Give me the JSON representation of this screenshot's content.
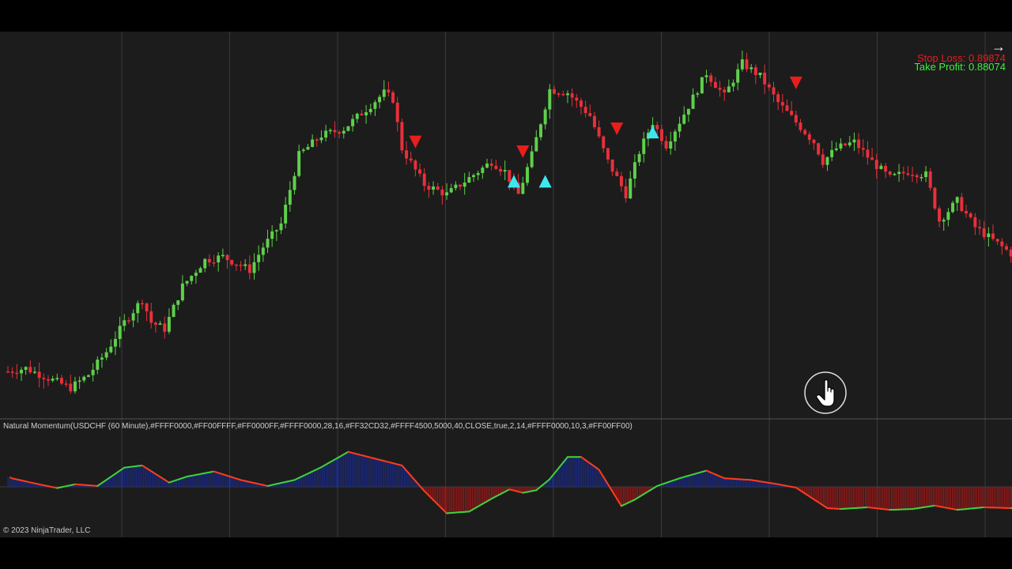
{
  "chart": {
    "stop_loss_label": "Stop Loss: 0.89874",
    "take_profit_label": "Take Profit: 0.88074",
    "indicator_label": "Natural Momentum(USDCHF (60 Minute),#FFFF0000,#FF00FFFF,#FF0000FF,#FFFF0000,28,16,#FF32CD32,#FFFF4500,5000,40,CLOSE,true,2,14,#FFFF0000,10,3,#FF00FF00)",
    "copyright": "© 2023 NinjaTrader, LLC"
  },
  "colors": {
    "background": "#1c1c1c",
    "grid": "#3a3a3a",
    "up_candle": "#5ed14a",
    "down_candle": "#e8303a",
    "buy_marker": "#3fe6ef",
    "sell_marker": "#e81e1e",
    "momentum_up": "#3fd13f",
    "momentum_down": "#ff3b1f",
    "histogram_positive": "#1a2a8a",
    "histogram_negative": "#a01818"
  },
  "chart_data": {
    "type": "candlestick",
    "symbol": "USDCHF",
    "timeframe": "60 Minute",
    "close_path": [
      [
        0,
        0.06
      ],
      [
        4,
        0.07
      ],
      [
        9,
        0.04
      ],
      [
        14,
        0.01
      ],
      [
        18,
        0.05
      ],
      [
        22,
        0.12
      ],
      [
        26,
        0.21
      ],
      [
        30,
        0.28
      ],
      [
        32,
        0.21
      ],
      [
        35,
        0.19
      ],
      [
        39,
        0.32
      ],
      [
        44,
        0.4
      ],
      [
        48,
        0.41
      ],
      [
        51,
        0.39
      ],
      [
        54,
        0.37
      ],
      [
        57,
        0.44
      ],
      [
        61,
        0.51
      ],
      [
        65,
        0.72
      ],
      [
        70,
        0.78
      ],
      [
        75,
        0.8
      ],
      [
        80,
        0.86
      ],
      [
        84,
        0.91
      ],
      [
        86,
        0.89
      ],
      [
        88,
        0.74
      ],
      [
        93,
        0.63
      ],
      [
        98,
        0.6
      ],
      [
        104,
        0.66
      ],
      [
        108,
        0.7
      ],
      [
        111,
        0.67
      ],
      [
        114,
        0.6
      ],
      [
        117,
        0.72
      ],
      [
        121,
        0.92
      ],
      [
        125,
        0.91
      ],
      [
        130,
        0.84
      ],
      [
        134,
        0.7
      ],
      [
        138,
        0.6
      ],
      [
        141,
        0.73
      ],
      [
        144,
        0.82
      ],
      [
        147,
        0.75
      ],
      [
        152,
        0.87
      ],
      [
        156,
        0.97
      ],
      [
        160,
        0.9
      ],
      [
        164,
        1.0
      ],
      [
        168,
        0.96
      ],
      [
        172,
        0.88
      ],
      [
        176,
        0.82
      ],
      [
        180,
        0.76
      ],
      [
        182,
        0.7
      ],
      [
        185,
        0.74
      ],
      [
        189,
        0.76
      ],
      [
        193,
        0.7
      ],
      [
        197,
        0.65
      ],
      [
        201,
        0.67
      ],
      [
        205,
        0.66
      ],
      [
        208,
        0.52
      ],
      [
        212,
        0.58
      ],
      [
        216,
        0.5
      ],
      [
        220,
        0.46
      ],
      [
        224,
        0.42
      ]
    ],
    "buy_signals": [
      [
        113,
        0.64
      ],
      [
        120,
        0.64
      ],
      [
        144,
        0.79
      ]
    ],
    "sell_signals": [
      [
        91,
        0.76
      ],
      [
        115,
        0.73
      ],
      [
        136,
        0.8
      ],
      [
        176,
        0.94
      ]
    ],
    "momentum": {
      "range": [
        -1,
        1
      ],
      "path": [
        [
          0,
          0.22
        ],
        [
          6,
          0.08
        ],
        [
          11,
          -0.03
        ],
        [
          15,
          0.06
        ],
        [
          20,
          0.02
        ],
        [
          26,
          0.45
        ],
        [
          30,
          0.5
        ],
        [
          36,
          0.1
        ],
        [
          40,
          0.24
        ],
        [
          46,
          0.36
        ],
        [
          52,
          0.16
        ],
        [
          58,
          0.02
        ],
        [
          64,
          0.16
        ],
        [
          70,
          0.46
        ],
        [
          76,
          0.82
        ],
        [
          82,
          0.66
        ],
        [
          88,
          0.5
        ],
        [
          93,
          -0.1
        ],
        [
          98,
          -0.62
        ],
        [
          103,
          -0.58
        ],
        [
          108,
          -0.28
        ],
        [
          112,
          -0.06
        ],
        [
          115,
          -0.14
        ],
        [
          118,
          -0.08
        ],
        [
          121,
          0.18
        ],
        [
          125,
          0.7
        ],
        [
          128,
          0.7
        ],
        [
          132,
          0.4
        ],
        [
          137,
          -0.45
        ],
        [
          140,
          -0.3
        ],
        [
          145,
          0.02
        ],
        [
          150,
          0.2
        ],
        [
          156,
          0.38
        ],
        [
          160,
          0.2
        ],
        [
          166,
          0.16
        ],
        [
          172,
          0.06
        ],
        [
          176,
          -0.02
        ],
        [
          183,
          -0.5
        ],
        [
          186,
          -0.52
        ],
        [
          192,
          -0.48
        ],
        [
          197,
          -0.54
        ],
        [
          202,
          -0.52
        ],
        [
          207,
          -0.44
        ],
        [
          212,
          -0.54
        ],
        [
          218,
          -0.48
        ],
        [
          224,
          -0.5
        ]
      ]
    }
  }
}
